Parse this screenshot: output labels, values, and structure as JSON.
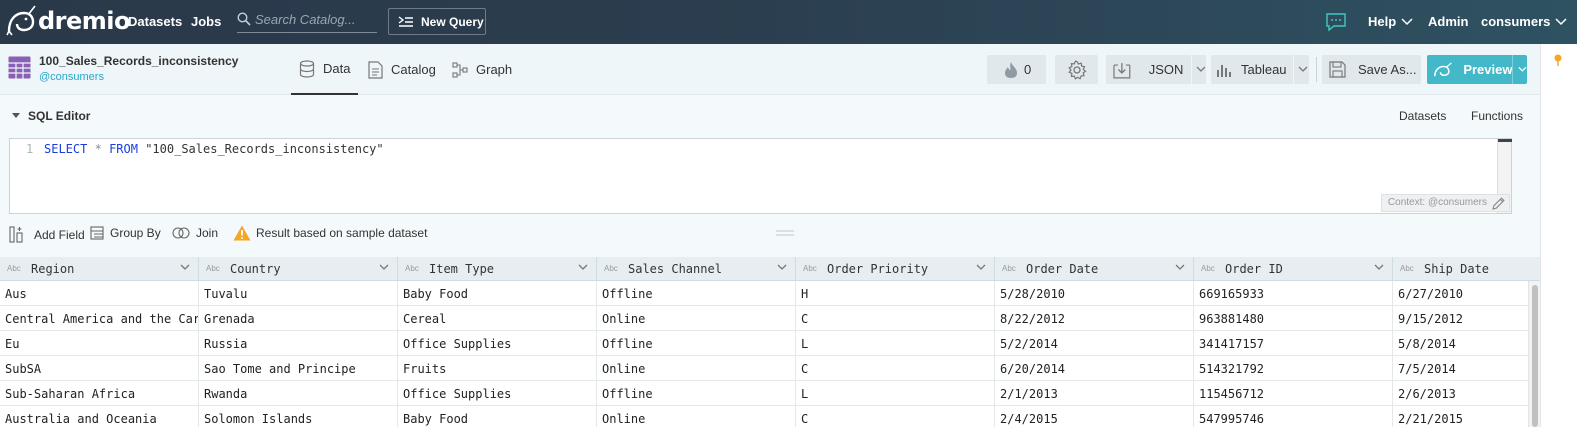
{
  "topbar": {
    "brand": "dremio",
    "nav": [
      "Datasets",
      "Jobs"
    ],
    "search_placeholder": "Search Catalog...",
    "new_query": "New Query",
    "help": "Help",
    "admin": "Admin",
    "user": "consumers",
    "icons": [
      "dremio-narwhal-logo",
      "search-icon",
      "new-query-icon",
      "chat-icon",
      "chevron-down-icon"
    ]
  },
  "dataset": {
    "name": "100_Sales_Records_inconsistency",
    "space": "@consumers",
    "tabs": [
      {
        "label": "Data",
        "icon": "database-icon",
        "active": true
      },
      {
        "label": "Catalog",
        "icon": "catalog-icon",
        "active": false
      },
      {
        "label": "Graph",
        "icon": "graph-icon",
        "active": false
      }
    ],
    "reflections_count": "0",
    "export_format": "JSON",
    "bi_tool": "Tableau",
    "save_as": "Save As...",
    "preview": "Preview"
  },
  "sql_editor": {
    "title": "SQL Editor",
    "links": [
      "Datasets",
      "Functions"
    ],
    "line_number": "1",
    "query": {
      "select": "SELECT",
      "star": "*",
      "from": "FROM",
      "table": "\"100_Sales_Records_inconsistency\""
    },
    "context": "Context: @consumers"
  },
  "toolbar": {
    "add_field": "Add Field",
    "group_by": "Group By",
    "join": "Join",
    "sample_notice": "Result based on sample dataset"
  },
  "table": {
    "type_label": "Abc",
    "columns": [
      "Region",
      "Country",
      "Item Type",
      "Sales Channel",
      "Order Priority",
      "Order Date",
      "Order ID",
      "Ship Date"
    ],
    "rows": [
      [
        "Aus",
        "Tuvalu",
        "Baby Food",
        "Offline",
        "H",
        "5/28/2010",
        "669165933",
        "6/27/2010"
      ],
      [
        "Central America and the Caribbean",
        "Grenada",
        "Cereal",
        "Online",
        "C",
        "8/22/2012",
        "963881480",
        "9/15/2012"
      ],
      [
        "Eu",
        "Russia",
        "Office Supplies",
        "Offline",
        "L",
        "5/2/2014",
        "341417157",
        "5/8/2014"
      ],
      [
        "SubSA",
        "Sao Tome and Principe",
        "Fruits",
        "Online",
        "C",
        "6/20/2014",
        "514321792",
        "7/5/2014"
      ],
      [
        "Sub-Saharan Africa",
        "Rwanda",
        "Office Supplies",
        "Offline",
        "L",
        "2/1/2013",
        "115456712",
        "2/6/2013"
      ],
      [
        "Australia and Oceania",
        "Solomon Islands",
        "Baby Food",
        "Online",
        "C",
        "2/4/2015",
        "547995746",
        "2/21/2015"
      ]
    ]
  },
  "colors": {
    "topbar": "#2b3d4e",
    "accent": "#43b8c9",
    "link": "#28a7c9",
    "warning": "#f5a623",
    "dataset_icon": "#8a5fb5"
  }
}
